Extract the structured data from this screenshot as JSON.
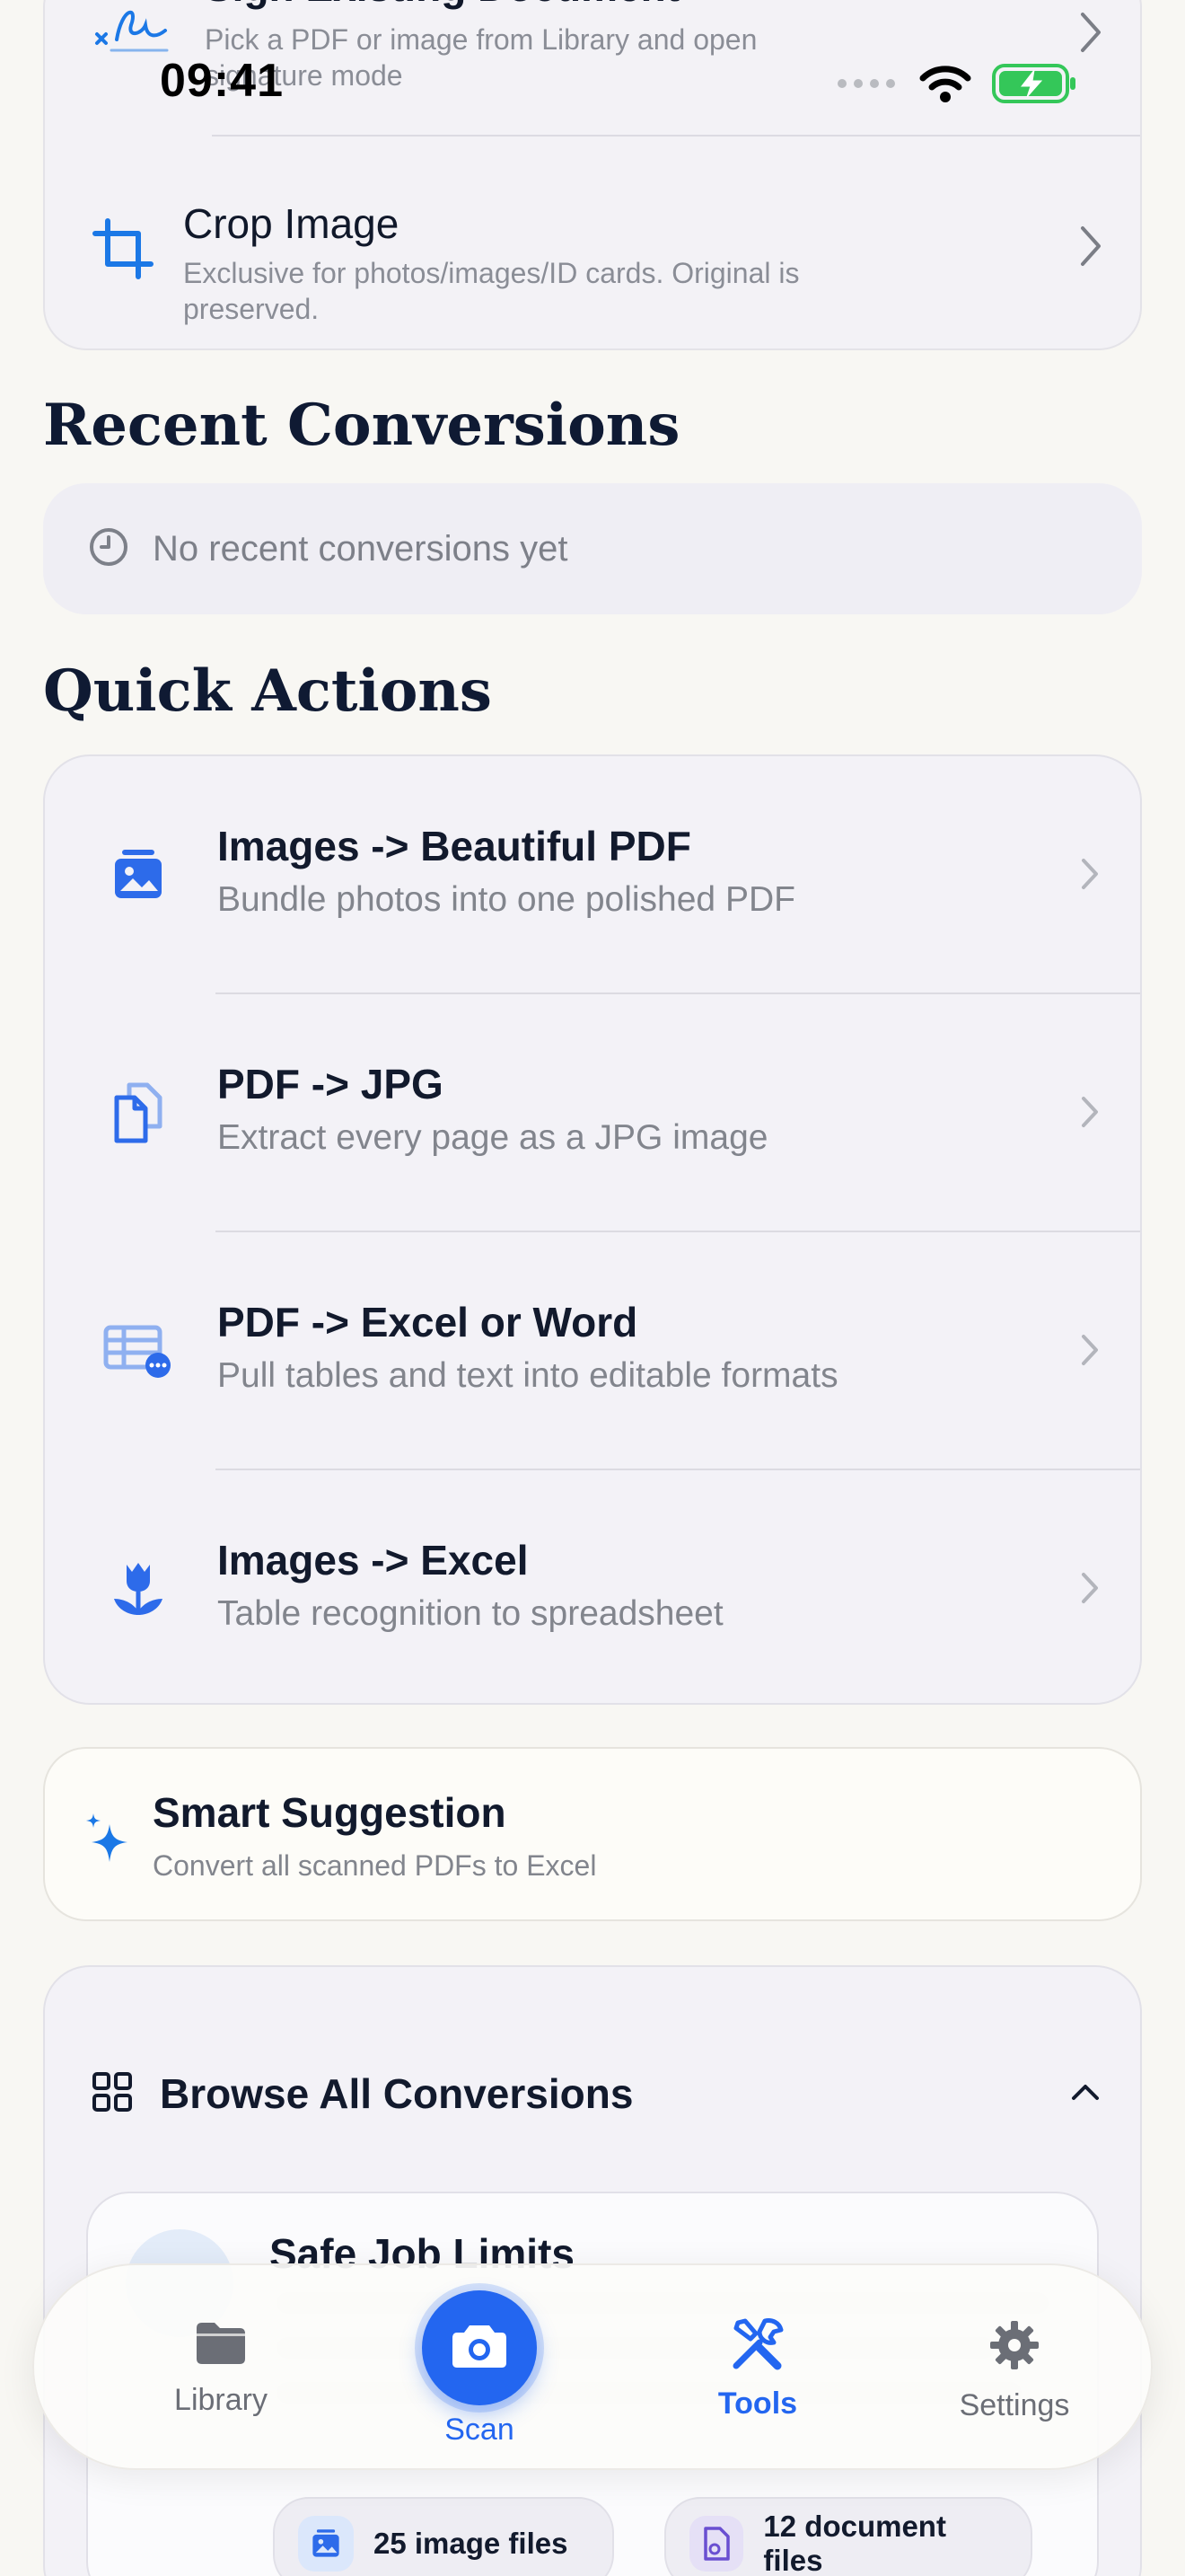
{
  "status_bar": {
    "time": "09:41"
  },
  "top_tools": [
    {
      "title": "Sign Existing Document",
      "subtitle": "Pick a PDF or image from Library and open signature mode",
      "icon": "signature-icon"
    },
    {
      "title": "Crop Image",
      "subtitle": "Exclusive for photos/images/ID cards. Original is preserved.",
      "icon": "crop-icon"
    }
  ],
  "recent": {
    "title": "Recent Conversions",
    "empty_text": "No recent conversions yet"
  },
  "quick_actions": {
    "title": "Quick Actions",
    "items": [
      {
        "title": "Images -> Beautiful PDF",
        "subtitle": "Bundle photos into one polished PDF",
        "icon": "image-stack-icon"
      },
      {
        "title": "PDF -> JPG",
        "subtitle": "Extract every page as a JPG image",
        "icon": "documents-icon"
      },
      {
        "title": "PDF -> Excel or Word",
        "subtitle": "Pull tables and text into editable formats",
        "icon": "table-icon"
      },
      {
        "title": "Images -> Excel",
        "subtitle": "Table recognition to spreadsheet",
        "icon": "tulip-icon"
      }
    ]
  },
  "smart_suggestion": {
    "title": "Smart Suggestion",
    "subtitle": "Convert all scanned PDFs to Excel"
  },
  "browse": {
    "title": "Browse All Conversions",
    "inner_title": "Safe Job Limits",
    "image_files": "25 image files",
    "document_files": "12 document files"
  },
  "tabbar": {
    "library": "Library",
    "scan": "Scan",
    "tools": "Tools",
    "settings": "Settings",
    "active": "Tools"
  },
  "colors": {
    "accent": "#2366f0",
    "battery": "#34c759",
    "background": "#f8f7f3"
  }
}
